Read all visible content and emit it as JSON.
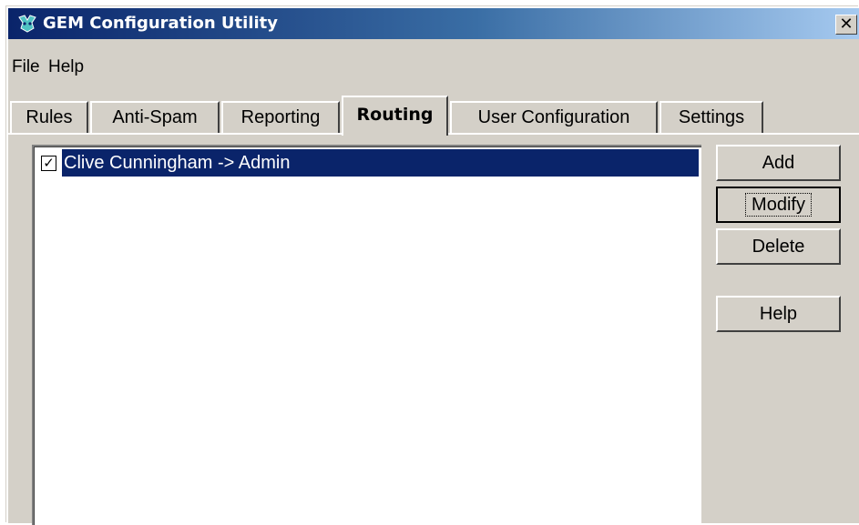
{
  "window": {
    "title": "GEM Configuration Utility",
    "close_glyph": "✕",
    "icon": "gem-app-icon"
  },
  "menu": {
    "items": [
      "File",
      "Help"
    ]
  },
  "tabs": [
    {
      "label": "Rules",
      "active": false
    },
    {
      "label": "Anti-Spam",
      "active": false
    },
    {
      "label": "Reporting",
      "active": false
    },
    {
      "label": "Routing",
      "active": true
    },
    {
      "label": "User Configuration",
      "active": false
    },
    {
      "label": "Settings",
      "active": false
    }
  ],
  "routing_list": {
    "items": [
      {
        "label": "Clive Cunningham -> Admin",
        "checked": true,
        "selected": true
      }
    ]
  },
  "buttons": {
    "add": "Add",
    "modify": "Modify",
    "delete": "Delete",
    "help": "Help"
  },
  "colors": {
    "selection": "#0a246a",
    "face": "#d4d0c8",
    "title_start": "#0a246a",
    "title_end": "#a6caf0"
  }
}
